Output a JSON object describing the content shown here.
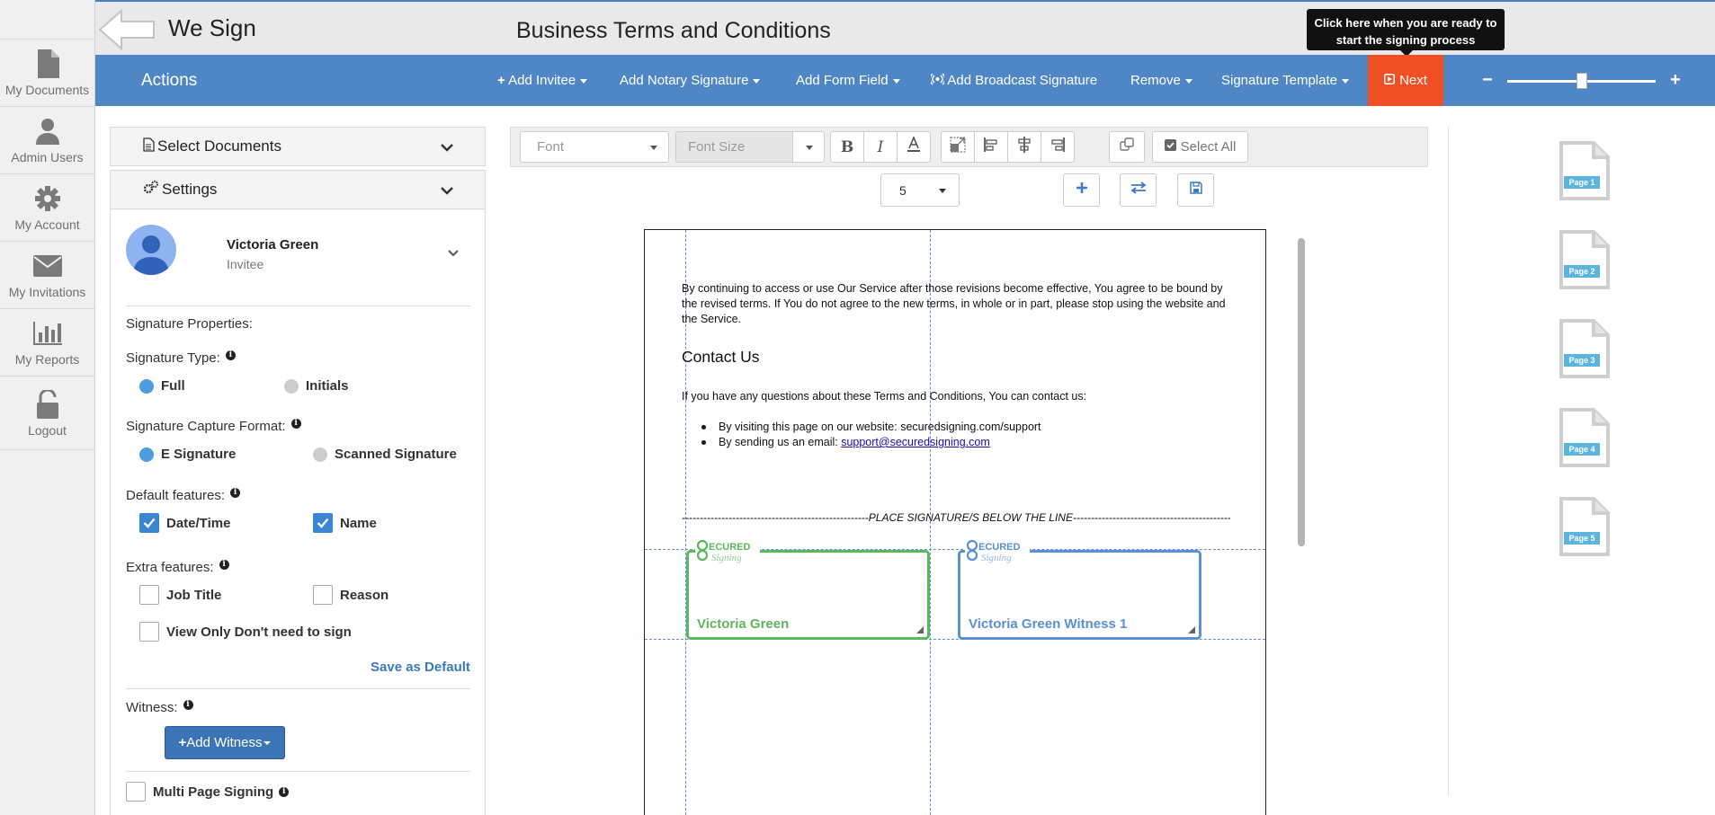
{
  "nav": {
    "items": [
      {
        "label": "My Documents",
        "icon": "document-icon"
      },
      {
        "label": "Admin Users",
        "icon": "user-icon"
      },
      {
        "label": "My Account",
        "icon": "gear-icon"
      },
      {
        "label": "My Invitations",
        "icon": "envelope-icon"
      },
      {
        "label": "My Reports",
        "icon": "bar-chart-icon"
      },
      {
        "label": "Logout",
        "icon": "unlock-icon"
      }
    ]
  },
  "header": {
    "app_name": "We Sign",
    "doc_title": "Business Terms and Conditions",
    "tooltip_line1": "Click here when you are ready to",
    "tooltip_line2": "start the signing process"
  },
  "actions": {
    "title": "Actions",
    "add_invitee": "Add Invitee",
    "add_notary": "Add Notary Signature",
    "add_form_field": "Add Form Field",
    "add_broadcast": "Add Broadcast Signature",
    "remove": "Remove",
    "signature_template": "Signature Template",
    "next": "Next",
    "zoom_level": 0.5
  },
  "panel": {
    "select_documents": "Select Documents",
    "settings": "Settings",
    "user_name": "Victoria Green",
    "user_role": "Invitee",
    "signature_properties": "Signature Properties:",
    "signature_type_label": "Signature Type:",
    "sig_type_full": "Full",
    "sig_type_initials": "Initials",
    "capture_format_label": "Signature Capture Format:",
    "capture_e": "E Signature",
    "capture_scanned": "Scanned Signature",
    "default_features_label": "Default features:",
    "feature_datetime": "Date/Time",
    "feature_name": "Name",
    "extra_features_label": "Extra features:",
    "extra_job_title": "Job Title",
    "extra_reason": "Reason",
    "extra_view_only": "View Only Don't need to sign",
    "save_default": "Save as Default",
    "witness_label": "Witness:",
    "add_witness": "Add Witness",
    "multi_page": "Multi Page Signing"
  },
  "toolbar": {
    "font_placeholder": "Font",
    "font_size_placeholder": "Font Size",
    "select_all": "Select All",
    "page_number": "5"
  },
  "document": {
    "para1": "By continuing to access or use Our Service after those revisions become effective, You agree to be bound by the revised terms. If You do not agree to the new terms, in whole or in part, please stop using the website and the Service.",
    "heading": "Contact Us",
    "para2": "If you have any questions about these Terms and Conditions, You can contact us:",
    "bullet1": "By visiting this page on our website: securedsigning.com/support",
    "bullet2_prefix": "By sending us an email: ",
    "bullet2_link": "support@securedsigning.com",
    "place_line": "----------------------------------------------------PLACE SIGNATURE/S BELOW THE LINE------------------------------------------------",
    "sig1_name": "Victoria Green",
    "sig2_name": "Victoria Green Witness 1",
    "logo_text_top": "ECURED",
    "logo_text_bottom": "Signing"
  },
  "thumbnails": [
    "Page 1",
    "Page 2",
    "Page 3",
    "Page 4",
    "Page 5"
  ],
  "colors": {
    "actions_bar": "#4f86c6",
    "next_button": "#f04e23",
    "sig_green": "#5cb85c",
    "sig_blue": "#5a90d4"
  }
}
